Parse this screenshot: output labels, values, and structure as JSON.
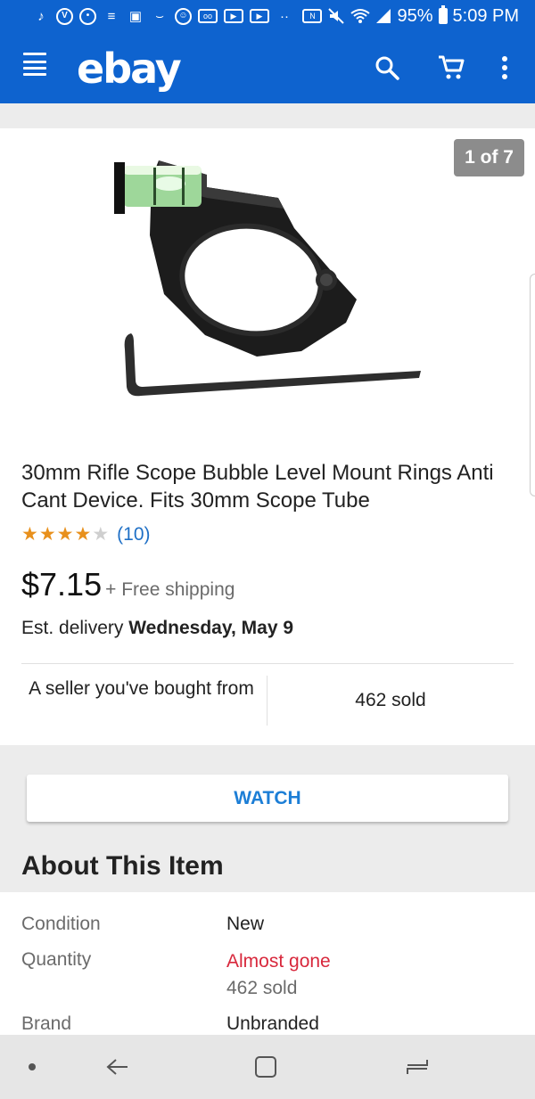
{
  "status_bar": {
    "battery": "95%",
    "time": "5:09 PM",
    "notification_icons": [
      "music-note-icon",
      "venmo-icon",
      "chat-icon",
      "news-icon",
      "gallery-icon",
      "amazon-icon",
      "account-icon",
      "voicemail-icon",
      "youtube-icon",
      "youtube-icon",
      "more-icon"
    ],
    "system_icons": [
      "nfc-icon",
      "mute-icon",
      "wifi-icon",
      "signal-icon",
      "battery-icon"
    ]
  },
  "app_bar": {
    "logo": "ebay",
    "background_color": "#0e63cf",
    "notification_color": "#e0302d"
  },
  "product": {
    "image_counter": "1 of 7",
    "title": "30mm Rifle Scope Bubble Level Mount Rings Anti Cant Device. Fits 30mm Scope Tube",
    "rating": {
      "stars_filled": 4,
      "stars_total": 5,
      "count": "(10)"
    },
    "price": "$7.15",
    "shipping": "+ Free shipping",
    "delivery_label": "Est. delivery",
    "delivery_date": "Wednesday, May 9",
    "seller_note": "A seller you've bought from",
    "sold_count": "462 sold"
  },
  "watch_button": {
    "label": "WATCH"
  },
  "about": {
    "heading": "About This Item",
    "rows": [
      {
        "label": "Condition",
        "value": "New"
      },
      {
        "label": "Quantity",
        "value": "Almost gone",
        "sub": "462 sold"
      },
      {
        "label": "Brand",
        "value": "Unbranded"
      }
    ]
  },
  "colors": {
    "link": "#1f70c6",
    "star": "#e8901c",
    "alert": "#d8283c"
  }
}
